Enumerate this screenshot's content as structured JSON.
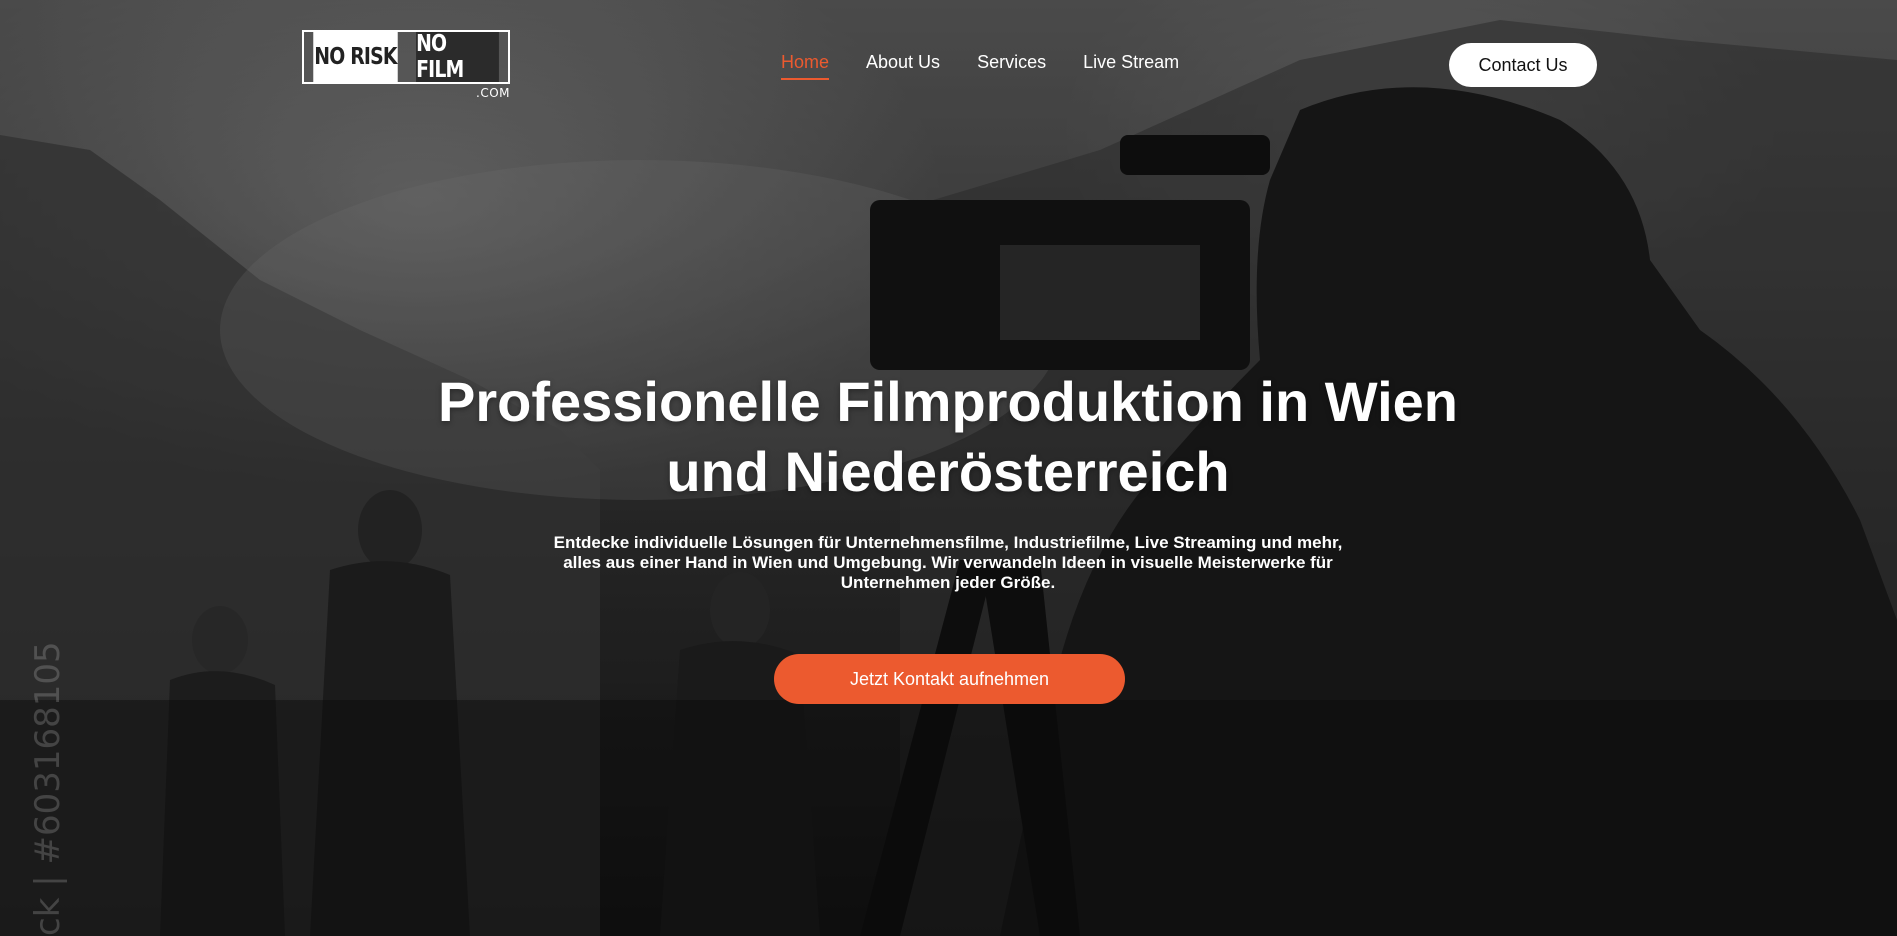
{
  "logo": {
    "left_text": "NO RISK",
    "right_text": "NO FILM",
    "suffix": ".COM"
  },
  "nav": {
    "items": [
      {
        "label": "Home",
        "active": true
      },
      {
        "label": "About Us",
        "active": false
      },
      {
        "label": "Services",
        "active": false
      },
      {
        "label": "Live Stream",
        "active": false
      }
    ]
  },
  "header": {
    "contact_label": "Contact Us"
  },
  "hero": {
    "headline_line1": "Professionelle Filmproduktion in Wien",
    "headline_line2": "und Niederösterreich",
    "description_line1": "Entdecke individuelle Lösungen für Unternehmensfilme, Industriefilme, Live Streaming und mehr,",
    "description_line2": "alles aus einer Hand in Wien und Umgebung. Wir verwandeln Ideen in visuelle Meisterwerke für",
    "description_line3": "Unternehmen jeder Größe.",
    "cta_label": "Jetzt Kontakt aufnehmen"
  },
  "watermark": {
    "text": "ck | #603168105"
  },
  "colors": {
    "accent": "#ec5a2f",
    "text": "#ffffff",
    "button_light": "#ffffff"
  }
}
